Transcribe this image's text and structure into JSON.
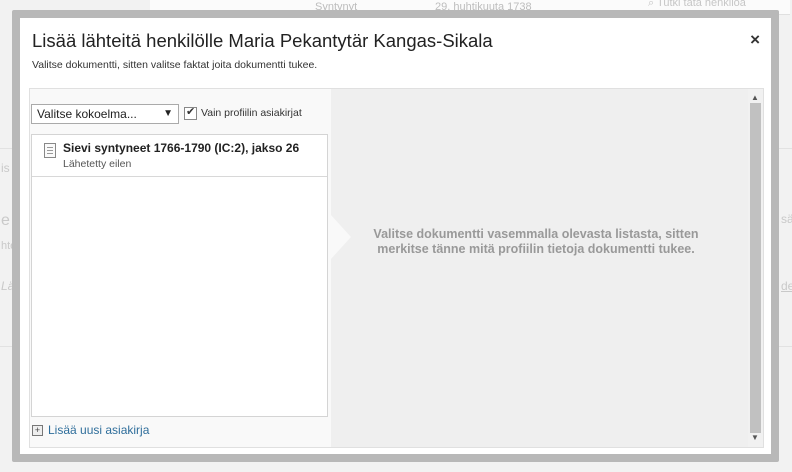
{
  "background": {
    "born_label": "Syntynyt",
    "born_value": "29. huhtikuuta 1738",
    "search_link": "Tutki tätä henkilöä",
    "left_fragments": [
      "is",
      "e",
      "hte",
      "Lä"
    ],
    "right_fragments": [
      "sä",
      "de"
    ]
  },
  "dialog": {
    "title": "Lisää lähteitä henkilölle Maria Pekantytär Kangas-Sikala",
    "subtitle": "Valitse dokumentti, sitten valitse faktat joita dokumentti tukee.",
    "close_label": "×",
    "collection_select": {
      "selected": "Valitse kokoelma...",
      "arrow": "▼"
    },
    "profile_only": {
      "checked": true,
      "label": "Vain profiilin asiakirjat"
    },
    "documents": [
      {
        "title": "Sievi syntyneet 1766-1790 (IC:2), jakso 26",
        "status": "Lähetetty eilen"
      }
    ],
    "add_document_label": "Lisää uusi asiakirja",
    "placeholder": "Valitse dokumentti vasemmalla olevasta listasta, sitten merkitse tänne mitä profiilin tietoja dokumentti tukee.",
    "scroll_up": "▲",
    "scroll_down": "▼"
  }
}
